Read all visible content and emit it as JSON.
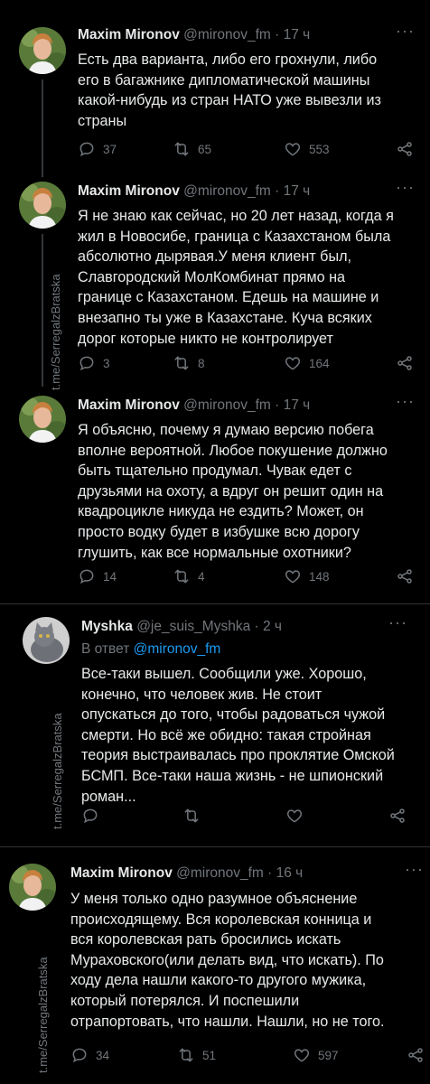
{
  "watermark": "t.me/SerregalzBratska",
  "tweets": [
    {
      "name": "Maxim Mironov",
      "handle": "@mironov_fm",
      "time": "· 17 ч",
      "text": "Есть два варианта, либо его грохнули, либо\nего в багажнике дипломатической машины\nкакой-нибудь из стран НАТО уже вывезли из\nстраны",
      "replies": "37",
      "retweets": "65",
      "likes": "553"
    },
    {
      "name": "Maxim Mironov",
      "handle": "@mironov_fm",
      "time": "· 17 ч",
      "text": "Я не знаю как сейчас, но 20 лет назад, когда я\nжил в Новосибе, граница с Казахстаном была\nабсолютно дырявая.У меня клиент был,\nСлавгородский МолКомбинат прямо на\nгранице с Казахстаном. Едешь на машине и\nвнезапно ты уже в Казахстане. Куча всяких\nдорог которые никто не контролирует",
      "replies": "3",
      "retweets": "8",
      "likes": "164"
    },
    {
      "name": "Maxim Mironov",
      "handle": "@mironov_fm",
      "time": "· 17 ч",
      "text": "Я объясню, почему я думаю версию побега\nвполне вероятной. Любое покушение должно\nбыть тщательно продумал. Чувак едет с\nдрузьями на охоту, а вдруг он решит один на\nквадроцикле никуда не ездить? Может, он\nпросто водку будет в избушке всю дорогу\nглушить, как все нормальные охотники?",
      "replies": "14",
      "retweets": "4",
      "likes": "148"
    },
    {
      "name": "Myshka",
      "handle": "@je_suis_Myshka",
      "time": "· 2 ч",
      "reply_prefix": "В ответ",
      "reply_mention": "@mironov_fm",
      "text": "Все-таки вышел. Сообщили уже. Хорошо,\nконечно, что человек жив. Не стоит\nопускаться до того, чтобы радоваться чужой\nсмерти. Но всё же обидно: такая стройная\nтеория выстраивалась про проклятие Омской\nБСМП. Все-таки наша жизнь - не шпионский\nроман...",
      "replies": "",
      "retweets": "",
      "likes": ""
    },
    {
      "name": "Maxim Mironov",
      "handle": "@mironov_fm",
      "time": "· 16 ч",
      "text": "У меня только одно разумное объяснение\nпроисходящему. Вся королевская конница и\nвся королевская рать бросились искать\nМураховского(или делать вид, что искать). По\nходу дела нашли какого-то другого мужика,\nкоторый потерялся. И поспешили\nотрапортовать, что нашли. Нашли, но не того.",
      "replies": "34",
      "retweets": "51",
      "likes": "597"
    }
  ],
  "colors": {
    "background": "#000000",
    "text": "#e7e9ea",
    "muted": "#71767b",
    "link": "#1d9bf0"
  },
  "icons": [
    "reply-icon",
    "retweet-icon",
    "like-icon",
    "share-icon",
    "more-icon"
  ]
}
